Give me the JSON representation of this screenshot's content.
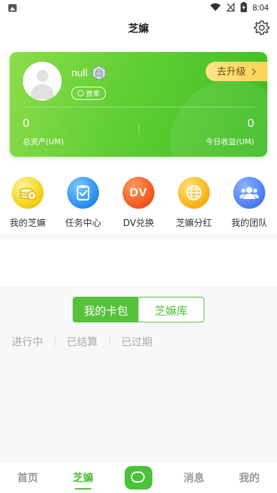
{
  "status_bar": {
    "time": "8:04"
  },
  "header": {
    "title": "芝嫲"
  },
  "account_card": {
    "username": "null",
    "rate_label": "费率",
    "upgrade_label": "去升级",
    "total_assets_value": "0",
    "total_assets_label": "总资产(UM)",
    "today_income_value": "0",
    "today_income_label": "今日收益(UM)",
    "brand_color": "#5fcf33"
  },
  "menu": [
    {
      "label": "我的芝嫲",
      "icon": "coins-icon",
      "color": "#f2d51b"
    },
    {
      "label": "任务中心",
      "icon": "clipboard-check-icon",
      "color": "#2b8ff0"
    },
    {
      "label": "DV兑换",
      "icon": "dv-icon",
      "icon_text": "DV",
      "color": "#f2571f"
    },
    {
      "label": "芝嫲分红",
      "icon": "globe-icon",
      "color": "#f6b417"
    },
    {
      "label": "我的团队",
      "icon": "team-icon",
      "color": "#4d7df2"
    }
  ],
  "wallet": {
    "segments": [
      {
        "label": "我的卡包",
        "active": true
      },
      {
        "label": "芝嫲库",
        "active": false
      }
    ],
    "filters": [
      "进行中",
      "已结算",
      "已过期"
    ]
  },
  "tabbar": {
    "items": [
      {
        "label": "首页",
        "active": false
      },
      {
        "label": "芝嫲",
        "active": true
      },
      {
        "label": "",
        "center": true
      },
      {
        "label": "消息",
        "active": false
      },
      {
        "label": "我的",
        "active": false
      }
    ],
    "accent": "#4fbd38"
  }
}
